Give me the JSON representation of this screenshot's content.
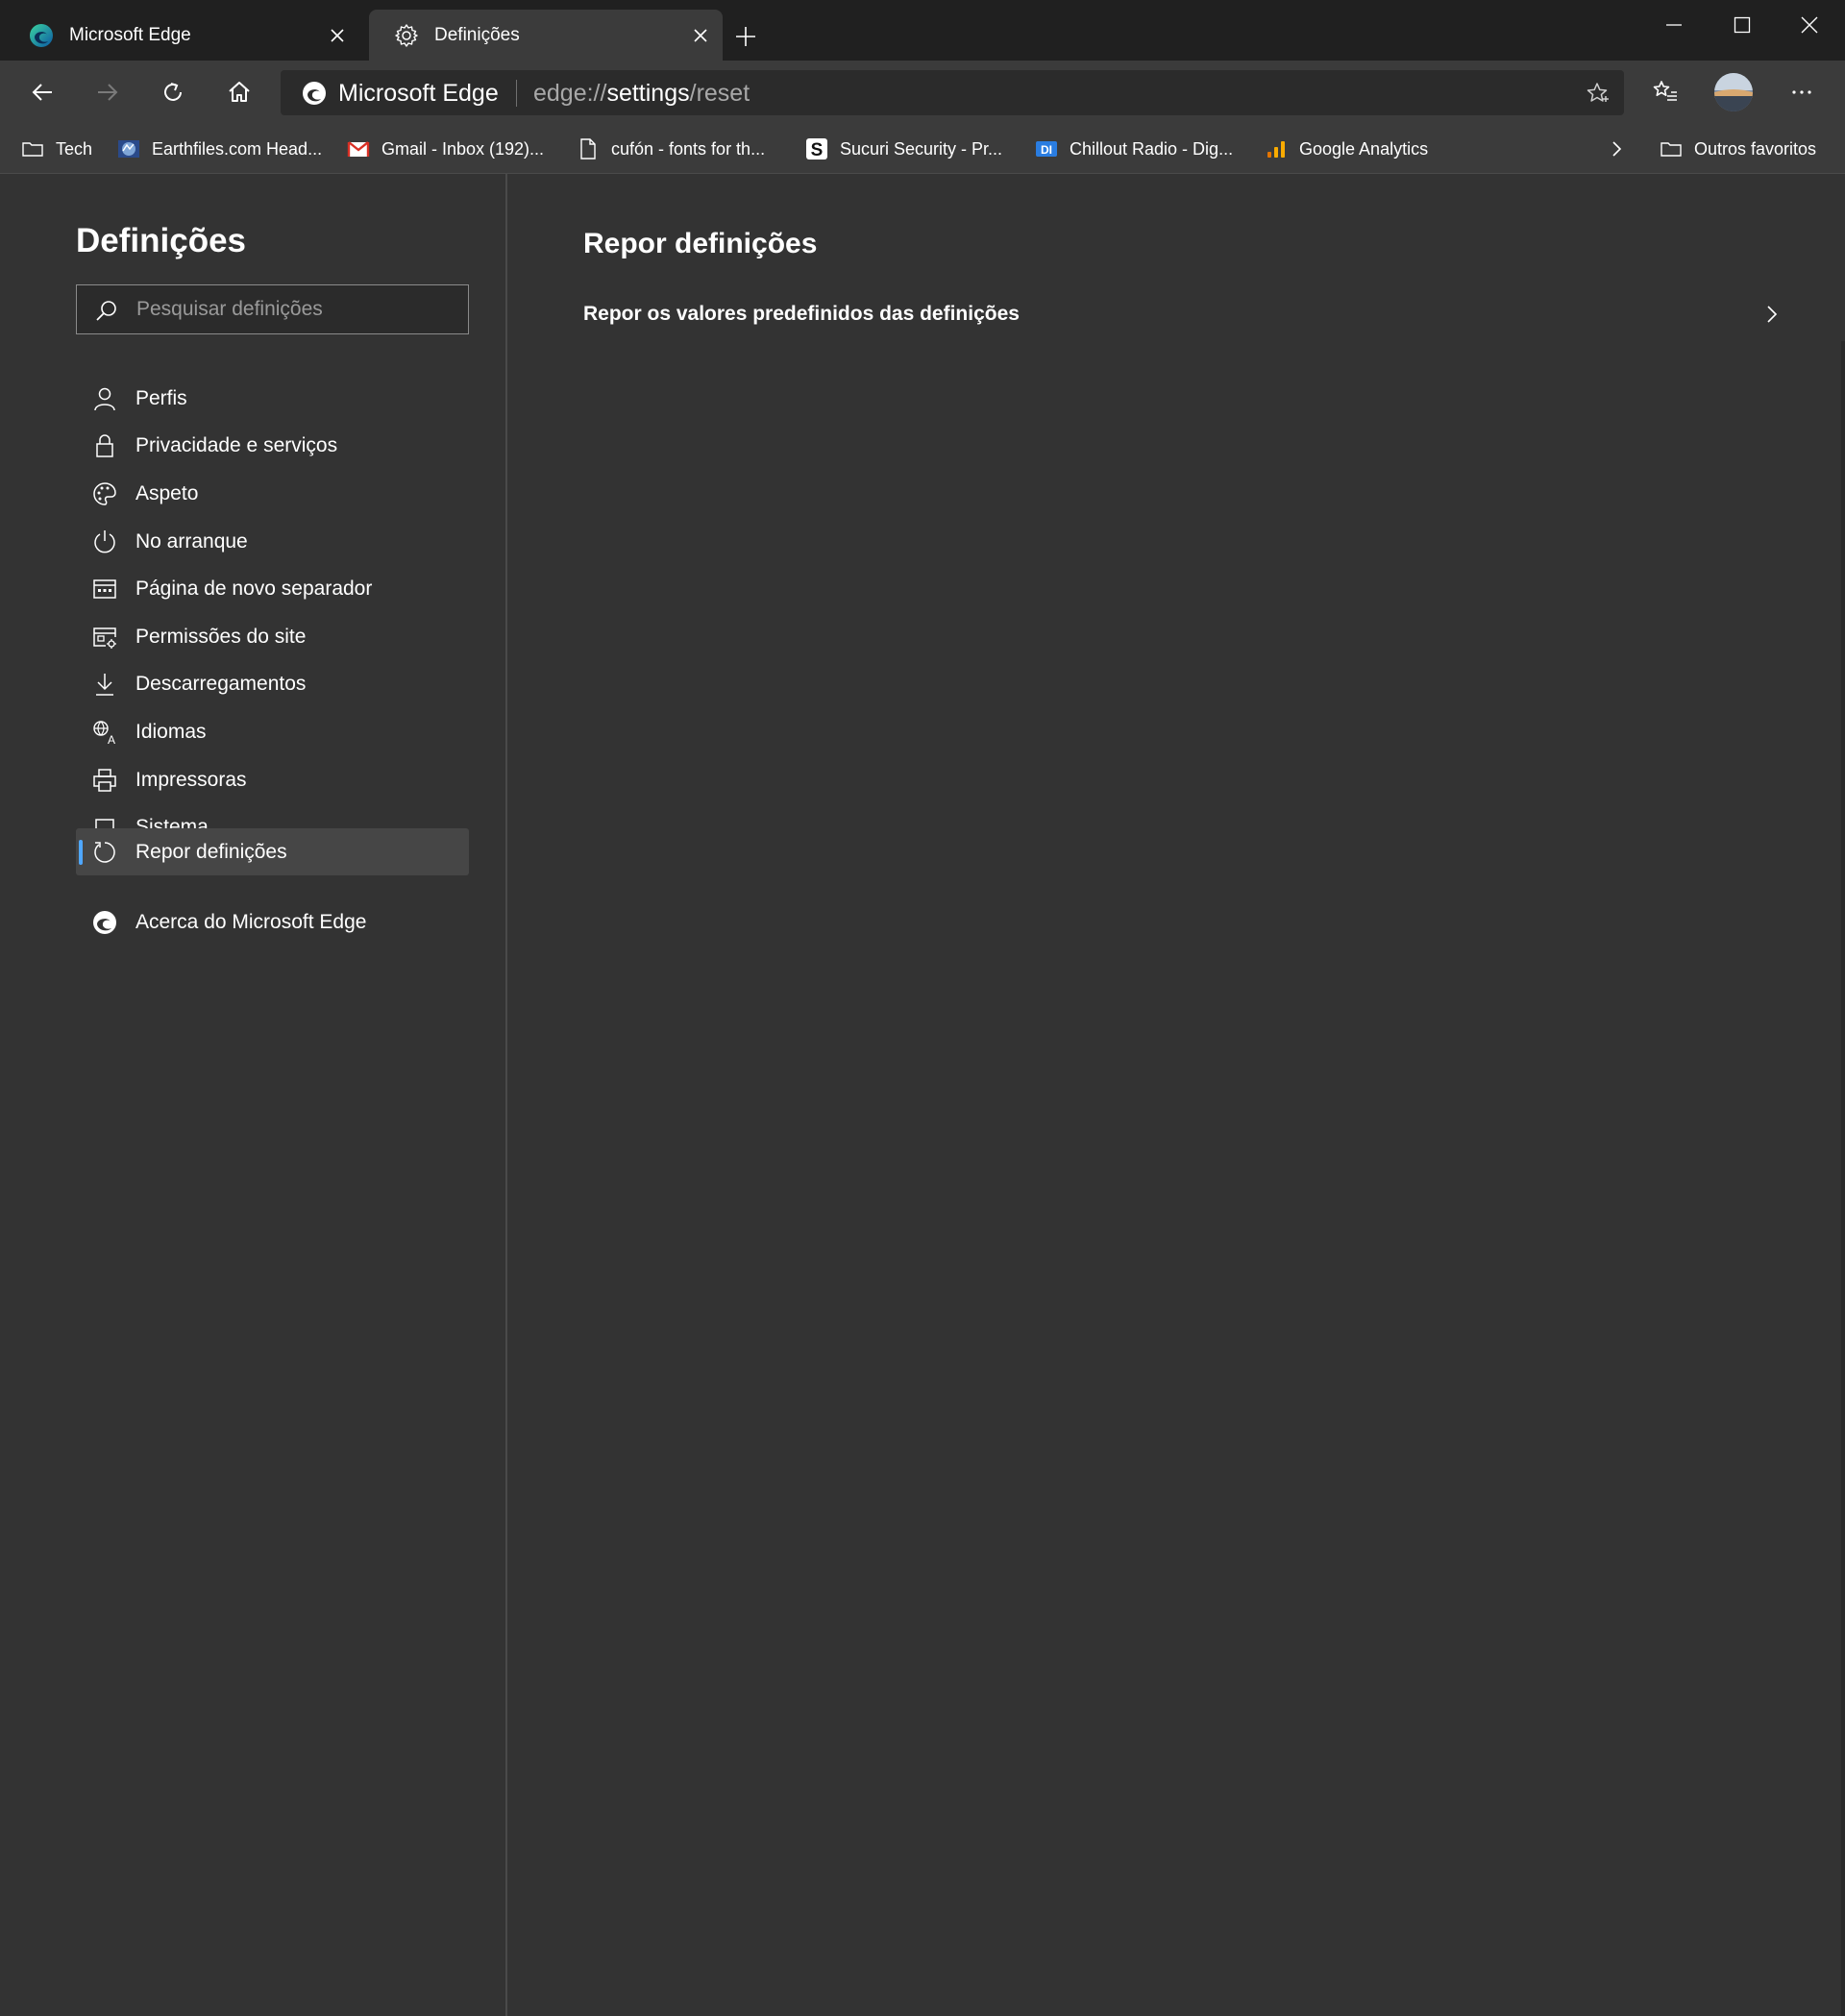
{
  "tabs": [
    {
      "label": "Microsoft Edge",
      "icon": "edge-logo-icon"
    },
    {
      "label": "Definições",
      "icon": "gear-icon",
      "active": true
    }
  ],
  "address": {
    "site_name": "Microsoft Edge",
    "url_scheme": "edge://",
    "url_host": "settings",
    "url_path": "/reset"
  },
  "bookmarks": [
    {
      "label": "Tech",
      "icon": "folder-icon"
    },
    {
      "label": "Earthfiles.com Head...",
      "icon": "earthfiles-icon"
    },
    {
      "label": "Gmail - Inbox (192)...",
      "icon": "gmail-icon"
    },
    {
      "label": "cufón - fonts for th...",
      "icon": "page-icon"
    },
    {
      "label": "Sucuri Security - Pr...",
      "icon": "sucuri-icon"
    },
    {
      "label": "Chillout Radio - Dig...",
      "icon": "di-icon"
    },
    {
      "label": "Google Analytics",
      "icon": "analytics-icon"
    }
  ],
  "other_favorites": "Outros favoritos",
  "sidebar": {
    "title": "Definições",
    "search_placeholder": "Pesquisar definições",
    "items": [
      {
        "label": "Perfis",
        "icon": "person-icon"
      },
      {
        "label": "Privacidade e serviços",
        "icon": "lock-icon"
      },
      {
        "label": "Aspeto",
        "icon": "palette-icon"
      },
      {
        "label": "No arranque",
        "icon": "power-icon"
      },
      {
        "label": "Página de novo separador",
        "icon": "new-tab-page-icon"
      },
      {
        "label": "Permissões do site",
        "icon": "site-permissions-icon"
      },
      {
        "label": "Descarregamentos",
        "icon": "download-icon"
      },
      {
        "label": "Idiomas",
        "icon": "languages-icon"
      },
      {
        "label": "Impressoras",
        "icon": "printer-icon"
      },
      {
        "label": "Sistema",
        "icon": "laptop-icon"
      },
      {
        "label": "Repor definições",
        "icon": "reset-icon",
        "active": true
      },
      {
        "label": "Acerca do Microsoft Edge",
        "icon": "edge-logo-icon"
      }
    ]
  },
  "main": {
    "title": "Repor definições",
    "reset_row_label": "Repor os valores predefinidos das definições"
  },
  "colors": {
    "accent": "#4fa7ff",
    "background": "#333333",
    "tabstrip": "#202020",
    "toolbar": "#3b3b3b"
  }
}
